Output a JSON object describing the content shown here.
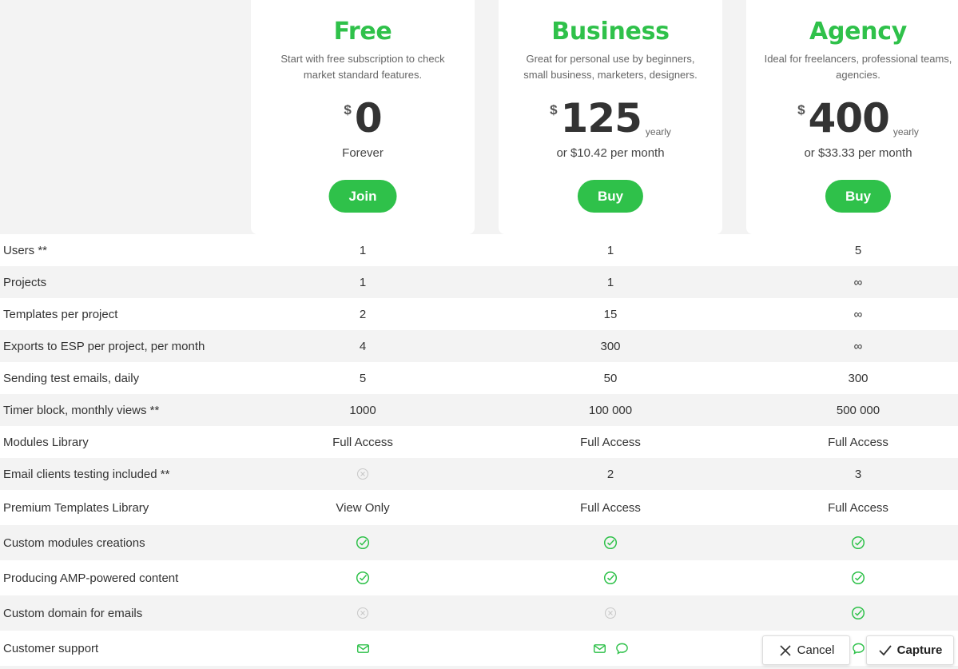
{
  "plans": [
    {
      "name": "Free",
      "description": "Start with free subscription to check market standard features.",
      "currency": "$",
      "amount": "0",
      "period": "",
      "sub": "Forever",
      "cta": "Join"
    },
    {
      "name": "Business",
      "description": "Great for personal use by beginners, small business, marketers, designers.",
      "currency": "$",
      "amount": "125",
      "period": "yearly",
      "sub": "or $10.42 per month",
      "cta": "Buy"
    },
    {
      "name": "Agency",
      "description": "Ideal for freelancers, professional teams, agencies.",
      "currency": "$",
      "amount": "400",
      "period": "yearly",
      "sub": "or $33.33 per month",
      "cta": "Buy"
    }
  ],
  "features": [
    {
      "label": "Users **",
      "values": [
        "1",
        "1",
        "5"
      ]
    },
    {
      "label": "Projects",
      "values": [
        "1",
        "1",
        "∞"
      ]
    },
    {
      "label": "Templates per project",
      "values": [
        "2",
        "15",
        "∞"
      ]
    },
    {
      "label": "Exports to ESP per project, per month",
      "values": [
        "4",
        "300",
        "∞"
      ]
    },
    {
      "label": "Sending test emails, daily",
      "values": [
        "5",
        "50",
        "300"
      ]
    },
    {
      "label": "Timer block, monthly views **",
      "values": [
        "1000",
        "100 000",
        "500 000"
      ]
    },
    {
      "label": "Modules Library",
      "values": [
        "Full Access",
        "Full Access",
        "Full Access"
      ]
    },
    {
      "label": "Email clients testing included **",
      "values": [
        "",
        "2",
        "3"
      ],
      "icons": [
        "cross-circle-icon",
        "",
        ""
      ]
    },
    {
      "label": "Premium Templates Library",
      "values": [
        "View Only",
        "Full Access",
        "Full Access"
      ]
    },
    {
      "label": "Custom modules creations",
      "icons": [
        "check-circle-icon",
        "check-circle-icon",
        "check-circle-icon"
      ]
    },
    {
      "label": "Producing AMP-powered content",
      "icons": [
        "check-circle-icon",
        "check-circle-icon",
        "check-circle-icon"
      ]
    },
    {
      "label": "Custom domain for emails",
      "icons": [
        "cross-circle-icon",
        "cross-circle-icon",
        "check-circle-icon"
      ]
    },
    {
      "label": "Customer support",
      "icons": [
        "envelope-icon",
        "envelope-icon chat-bubble-icon",
        "chat-bubble-icon"
      ]
    }
  ],
  "toolbar": {
    "cancel_label": "Cancel",
    "capture_label": "Capture"
  },
  "colors": {
    "accent": "#2fc14a",
    "muted_icon": "#c8c8c8",
    "background": "#f3f3f3"
  }
}
